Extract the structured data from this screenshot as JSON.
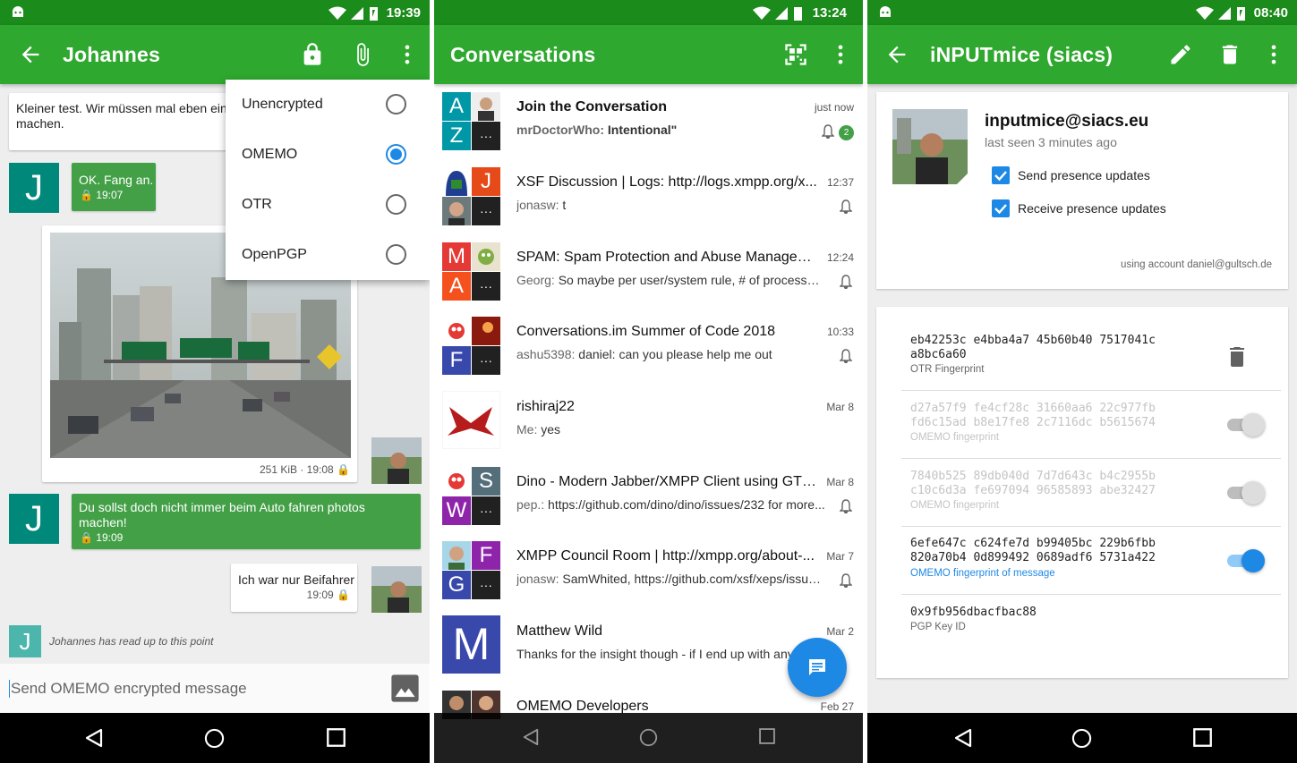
{
  "status": {
    "p1_time": "19:39",
    "p2_time": "13:24",
    "p3_time": "08:40"
  },
  "chat": {
    "title": "Johannes",
    "messages": [
      {
        "text": "Kleiner test. Wir müssen mal eben ein",
        "text2": "machen."
      },
      {
        "text": "OK. Fang an.",
        "meta": "19:07"
      },
      {
        "meta": "251 KiB · 19:08"
      },
      {
        "text": "Du sollst doch nicht immer beim Auto fahren photos",
        "text2": "machen!",
        "meta": "19:09"
      },
      {
        "text": "Ich war nur Beifahrer",
        "meta": "19:09"
      }
    ],
    "read_marker": "Johannes has read up to this point",
    "input_placeholder": "Send OMEMO encrypted message",
    "avatar_letter": "J",
    "menu": [
      {
        "label": "Unencrypted",
        "selected": false
      },
      {
        "label": "OMEMO",
        "selected": true
      },
      {
        "label": "OTR",
        "selected": false
      },
      {
        "label": "OpenPGP",
        "selected": false
      }
    ]
  },
  "conversations": {
    "title": "Conversations",
    "rows": [
      {
        "name": "Join the Conversation",
        "sender": "mrDoctorWho:",
        "msg": "Intentional\"",
        "ts": "just now",
        "badge": "2",
        "letters": [
          "A",
          "Z"
        ]
      },
      {
        "name": "XSF Discussion | Logs: http://logs.xmpp.org/x...",
        "sender": "jonasw:",
        "msg": "t",
        "ts": "12:37",
        "letters": [
          "J"
        ]
      },
      {
        "name": "SPAM: Spam Protection and Abuse Managem...",
        "sender": "Georg:",
        "msg": "So maybe per user/system rule, # of processed, ...",
        "ts": "12:24",
        "letters": [
          "M",
          "A"
        ]
      },
      {
        "name": "Conversations.im Summer of Code 2018",
        "sender": "ashu5398:",
        "msg": "daniel: can you please help me out",
        "ts": "10:33",
        "letters": [
          "F"
        ]
      },
      {
        "name": "rishiraj22",
        "sender": "Me:",
        "msg": "yes",
        "ts": "Mar 8",
        "letters": []
      },
      {
        "name": "Dino - Modern Jabber/XMPP Client using GTK...",
        "sender": "pep.:",
        "msg": "https://github.com/dino/dino/issues/232 for more...",
        "ts": "Mar 8",
        "letters": [
          "S",
          "W"
        ]
      },
      {
        "name": "XMPP Council Room | http://xmpp.org/about-...",
        "sender": "jonasw:",
        "msg": "SamWhited, https://github.com/xsf/xeps/issue...",
        "ts": "Mar 7",
        "letters": [
          "F",
          "G"
        ]
      },
      {
        "name": "Matthew Wild",
        "sender": "",
        "msg": "Thanks for the insight though - if I end up with any...",
        "ts": "Mar 2",
        "letters": [
          "M"
        ]
      },
      {
        "name": "OMEMO Developers",
        "sender": "",
        "msg": "",
        "ts": "Feb 27",
        "letters": []
      }
    ],
    "more_glyph": "···"
  },
  "contact": {
    "title": "iNPUTmice (siacs)",
    "jid": "inputmice@siacs.eu",
    "last_seen": "last seen 3 minutes ago",
    "send_presence": "Send presence updates",
    "receive_presence": "Receive presence updates",
    "account": "using account daniel@gultsch.de",
    "keys": [
      {
        "fp1": "eb42253c e4bba4a7 45b60b40 7517041c",
        "fp2": "a8bc6a60",
        "label": "OTR Fingerprint",
        "state": "delete"
      },
      {
        "fp1": "d27a57f9 fe4cf28c 31660aa6 22c977fb",
        "fp2": "fd6c15ad b8e17fe8 2c7116dc b5615674",
        "label": "OMEMO fingerprint",
        "state": "off"
      },
      {
        "fp1": "7840b525 89db040d 7d7d643c b4c2955b",
        "fp2": "c10c6d3a fe697094 96585893 abe32427",
        "label": "OMEMO fingerprint",
        "state": "off"
      },
      {
        "fp1": "6efe647c c624fe7d b99405bc 229b6fbb",
        "fp2": "820a70b4 0d899492 0689adf6 5731a422",
        "label": "OMEMO fingerprint of message",
        "state": "on"
      },
      {
        "fp1": "0x9fb956dbacfbac88",
        "fp2": "",
        "label": "PGP Key ID",
        "state": "none"
      }
    ]
  },
  "colors": {
    "status_bar": "#1b8b1b",
    "app_bar": "#2ea82e",
    "accent": "#1e88e5",
    "bubble_green": "#43a047"
  }
}
